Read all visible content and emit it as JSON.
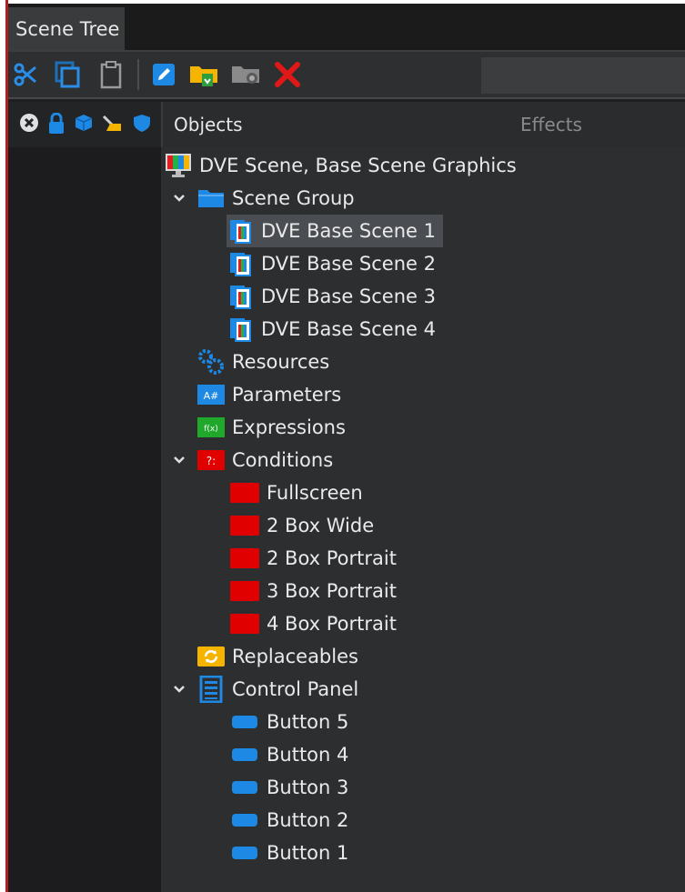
{
  "tab": {
    "label": "Scene Tree"
  },
  "columns": {
    "objects": "Objects",
    "effects": "Effects"
  },
  "tree": {
    "root": "DVE Scene, Base Scene Graphics",
    "scene_group": {
      "label": "Scene Group",
      "children": [
        "DVE Base Scene 1",
        "DVE Base Scene 2",
        "DVE Base Scene 3",
        "DVE Base Scene 4"
      ]
    },
    "resources": "Resources",
    "parameters": "Parameters",
    "parameters_icon_text": "A#",
    "expressions": "Expressions",
    "expressions_icon_text": "f(x)",
    "conditions": {
      "label": "Conditions",
      "icon_text": "?:",
      "children": [
        "Fullscreen",
        "2 Box Wide",
        "2 Box Portrait",
        "3 Box Portrait",
        "4 Box Portrait"
      ]
    },
    "replaceables": "Replaceables",
    "control_panel": {
      "label": "Control Panel",
      "children": [
        "Button 5",
        "Button 4",
        "Button 3",
        "Button 2",
        "Button 1"
      ]
    }
  },
  "colors": {
    "accent_blue": "#1e88e5",
    "condition_red": "#e00000",
    "folder_yellow": "#f5b400",
    "expression_green": "#1fa82b"
  }
}
